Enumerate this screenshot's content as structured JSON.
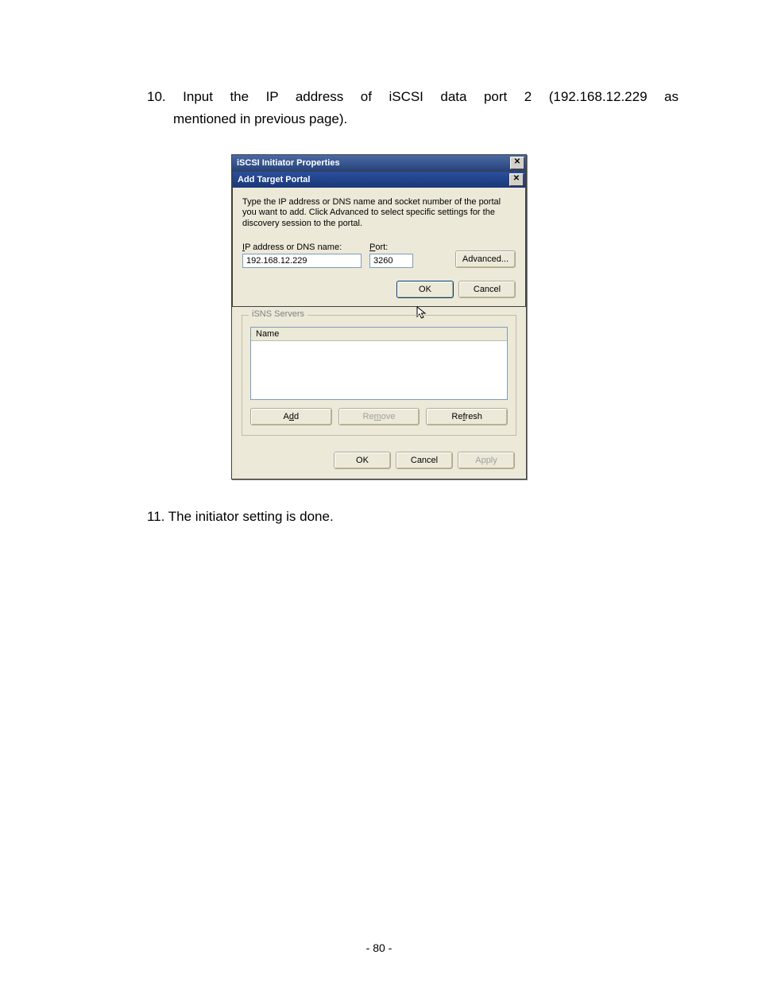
{
  "instructions": {
    "step10_num": "10.",
    "step10_line1": "Input the IP address of iSCSI data port 2 (192.168.12.229 as",
    "step10_line2": "mentioned in previous page).",
    "step11": "11.  The initiator setting is done."
  },
  "outer_window": {
    "title": "iSCSI Initiator Properties"
  },
  "modal": {
    "title": "Add Target Portal",
    "description": "Type the IP address or DNS name and socket number of the portal you want to add. Click Advanced to select specific settings for the discovery session to the portal.",
    "ip_label_pre": "I",
    "ip_label_post": "P address or DNS name:",
    "port_label_pre": "P",
    "port_label_post": "ort:",
    "ip_value": "192.168.12.229",
    "port_value": "3260",
    "advanced": "Advanced...",
    "ok": "OK",
    "cancel": "Cancel"
  },
  "isns": {
    "legend": "iSNS Servers",
    "name_header": "Name",
    "add_pre": "A",
    "add_u": "d",
    "add_post": "d",
    "remove_pre": "Re",
    "remove_u": "m",
    "remove_post": "ove",
    "refresh_pre": "Re",
    "refresh_u": "f",
    "refresh_post": "resh"
  },
  "outer_buttons": {
    "ok": "OK",
    "cancel": "Cancel",
    "apply": "Apply"
  },
  "page_number": "- 80 -"
}
